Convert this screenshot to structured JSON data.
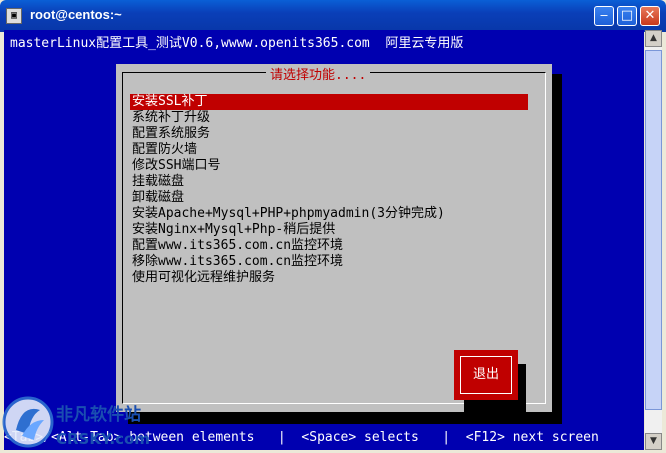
{
  "window": {
    "title": "root@centos:~"
  },
  "terminal": {
    "header": "masterLinux配置工具_测试V0.6,wwww.openits365.com  阿里云专用版"
  },
  "dialog": {
    "title": "请选择功能....",
    "items": [
      {
        "label": "安装SSL补丁",
        "selected": true
      },
      {
        "label": "系统补丁升级"
      },
      {
        "label": "配置系统服务"
      },
      {
        "label": "配置防火墙"
      },
      {
        "label": "修改SSH端口号"
      },
      {
        "label": "挂载磁盘"
      },
      {
        "label": "卸载磁盘"
      },
      {
        "label": "安装Apache+Mysql+PHP+phpmyadmin(3分钟完成)"
      },
      {
        "label": "安装Nginx+Mysql+Php-稍后提供"
      },
      {
        "label": "配置www.its365.com.cn监控环境"
      },
      {
        "label": "移除www.its365.com.cn监控环境"
      },
      {
        "label": "使用可视化远程维护服务"
      }
    ],
    "quit_label": "退出"
  },
  "statusbar": {
    "text": "<Tab>/<Alt-Tab> between elements   |  <Space> selects   |  <F12> next screen"
  },
  "watermark": {
    "brand": "非凡软件站",
    "sub": "CRSKY.com"
  },
  "colors": {
    "terminal_bg": "#0000b0",
    "dialog_bg": "#c0c0c0",
    "accent": "#c00000"
  }
}
